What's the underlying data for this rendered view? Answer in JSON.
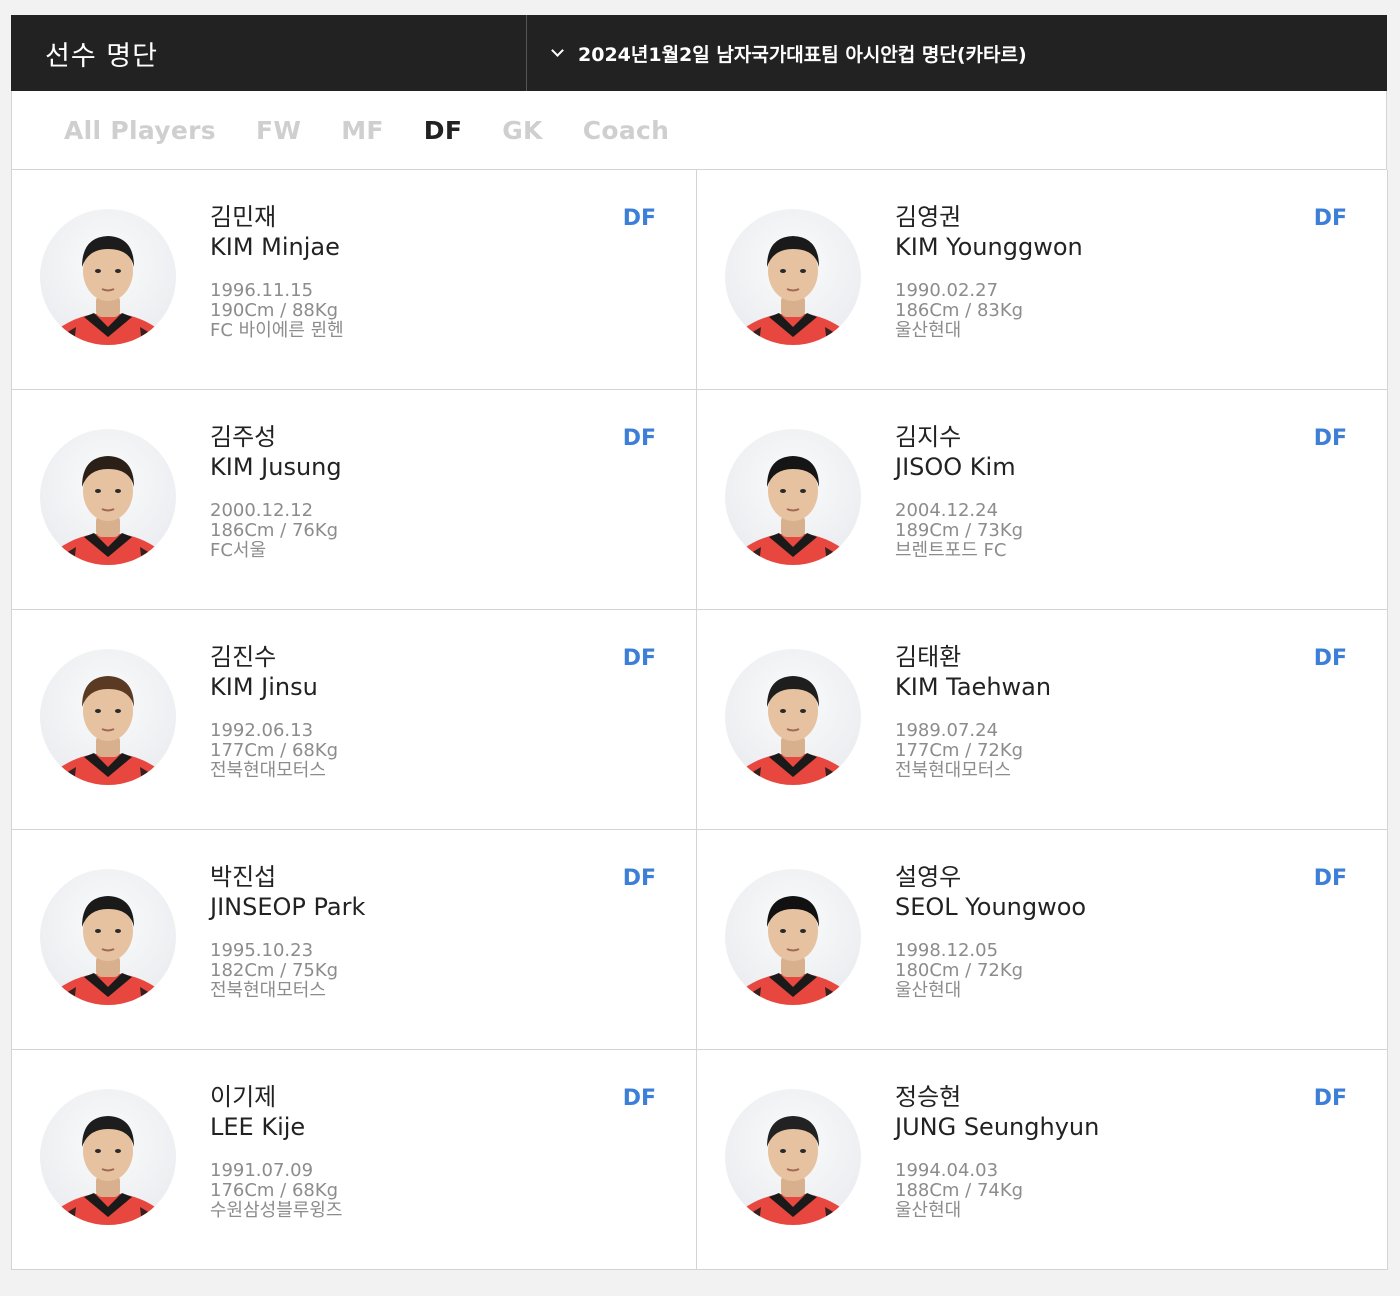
{
  "header": {
    "title": "선수 명단",
    "roster_select": "2024년1월2일 남자국가대표팀 아시안컵 명단(카타르)"
  },
  "tabs": [
    {
      "label": "All Players",
      "active": false
    },
    {
      "label": "FW",
      "active": false
    },
    {
      "label": "MF",
      "active": false
    },
    {
      "label": "DF",
      "active": true
    },
    {
      "label": "GK",
      "active": false
    },
    {
      "label": "Coach",
      "active": false
    }
  ],
  "colors": {
    "accent": "#3d7fd6",
    "header_bg": "#222222",
    "jersey": "#e8473f"
  },
  "players": [
    {
      "kname": "김민재",
      "ename": "KIM Minjae",
      "birth": "1996.11.15",
      "body": "190Cm / 88Kg",
      "club": "FC 바이에른 뮌헨",
      "position": "DF"
    },
    {
      "kname": "김영권",
      "ename": "KIM Younggwon",
      "birth": "1990.02.27",
      "body": "186Cm / 83Kg",
      "club": "울산현대",
      "position": "DF"
    },
    {
      "kname": "김주성",
      "ename": "KIM Jusung",
      "birth": "2000.12.12",
      "body": "186Cm / 76Kg",
      "club": "FC서울",
      "position": "DF"
    },
    {
      "kname": "김지수",
      "ename": "JISOO Kim",
      "birth": "2004.12.24",
      "body": "189Cm / 73Kg",
      "club": "브렌트포드 FC",
      "position": "DF"
    },
    {
      "kname": "김진수",
      "ename": "KIM Jinsu",
      "birth": "1992.06.13",
      "body": "177Cm / 68Kg",
      "club": "전북현대모터스",
      "position": "DF"
    },
    {
      "kname": "김태환",
      "ename": "KIM Taehwan",
      "birth": "1989.07.24",
      "body": "177Cm / 72Kg",
      "club": "전북현대모터스",
      "position": "DF"
    },
    {
      "kname": "박진섭",
      "ename": "JINSEOP Park",
      "birth": "1995.10.23",
      "body": "182Cm / 75Kg",
      "club": "전북현대모터스",
      "position": "DF"
    },
    {
      "kname": "설영우",
      "ename": "SEOL Youngwoo",
      "birth": "1998.12.05",
      "body": "180Cm / 72Kg",
      "club": "울산현대",
      "position": "DF"
    },
    {
      "kname": "이기제",
      "ename": "LEE Kije",
      "birth": "1991.07.09",
      "body": "176Cm / 68Kg",
      "club": "수원삼성블루윙즈",
      "position": "DF"
    },
    {
      "kname": "정승현",
      "ename": "JUNG Seunghyun",
      "birth": "1994.04.03",
      "body": "188Cm / 74Kg",
      "club": "울산현대",
      "position": "DF"
    }
  ]
}
